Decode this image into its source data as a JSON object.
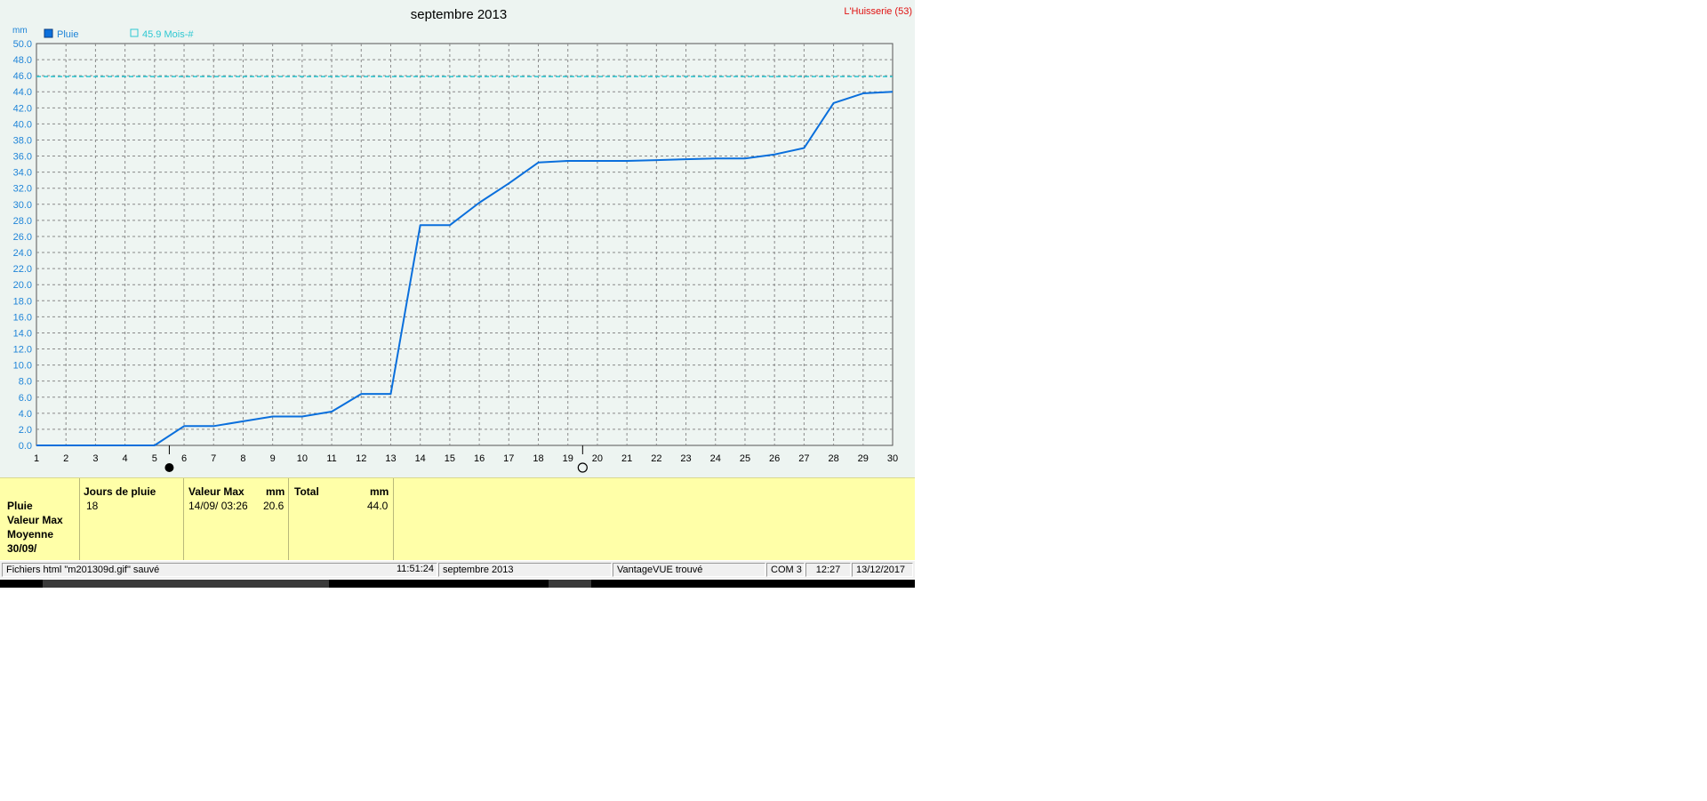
{
  "chart_data": {
    "type": "line",
    "title": "septembre 2013",
    "station": "L'Huisserie (53)",
    "ylabel": "mm",
    "ylim": [
      0,
      50
    ],
    "ytick_step": 2,
    "x": [
      1,
      2,
      3,
      4,
      5,
      6,
      7,
      8,
      9,
      10,
      11,
      12,
      13,
      14,
      15,
      16,
      17,
      18,
      19,
      20,
      21,
      22,
      23,
      24,
      25,
      26,
      27,
      28,
      29,
      30
    ],
    "xlim": [
      1,
      30
    ],
    "grid": true,
    "legend_position": "top-left",
    "series": [
      {
        "name": "Pluie",
        "color": "#0a6fdc",
        "values": [
          0.0,
          0.0,
          0.0,
          0.0,
          0.0,
          2.4,
          2.4,
          3.0,
          3.6,
          3.6,
          4.2,
          6.4,
          6.4,
          27.4,
          27.4,
          30.2,
          32.6,
          35.2,
          35.4,
          35.4,
          35.4,
          35.5,
          35.6,
          35.7,
          35.7,
          36.2,
          37.0,
          42.6,
          43.8,
          44.0
        ]
      }
    ],
    "reference_line": {
      "label": "45.9 Mois-#",
      "value": 45.9,
      "color": "#2ec8d2"
    },
    "moon_markers": [
      {
        "day": 5.5,
        "phase": "new-moon"
      },
      {
        "day": 19.5,
        "phase": "full-moon"
      }
    ]
  },
  "stats": {
    "row_labels": [
      "Pluie",
      "Valeur Max",
      "Moyenne",
      "30/09/"
    ],
    "jours_de_pluie": {
      "header": "Jours de pluie",
      "value": "18"
    },
    "valeur_max": {
      "header": "Valeur Max",
      "unit": "mm",
      "date": "14/09/  03:26",
      "value": "20.6"
    },
    "total": {
      "header": "Total",
      "unit": "mm",
      "value": "44.0"
    }
  },
  "status_bar": {
    "message": "Fichiers html  \"m201309d.gif\"  sauvé",
    "time_saved": "11:51:24",
    "month": "septembre 2013",
    "station_status": "VantageVUE trouvé",
    "port": "COM 3",
    "clock": "12:27",
    "date": "13/12/2017"
  },
  "colors": {
    "chart_bg": "#edf4f1",
    "axis_text": "#1e84d8",
    "stats_bg": "#ffffa8",
    "station_text": "#e01010"
  }
}
